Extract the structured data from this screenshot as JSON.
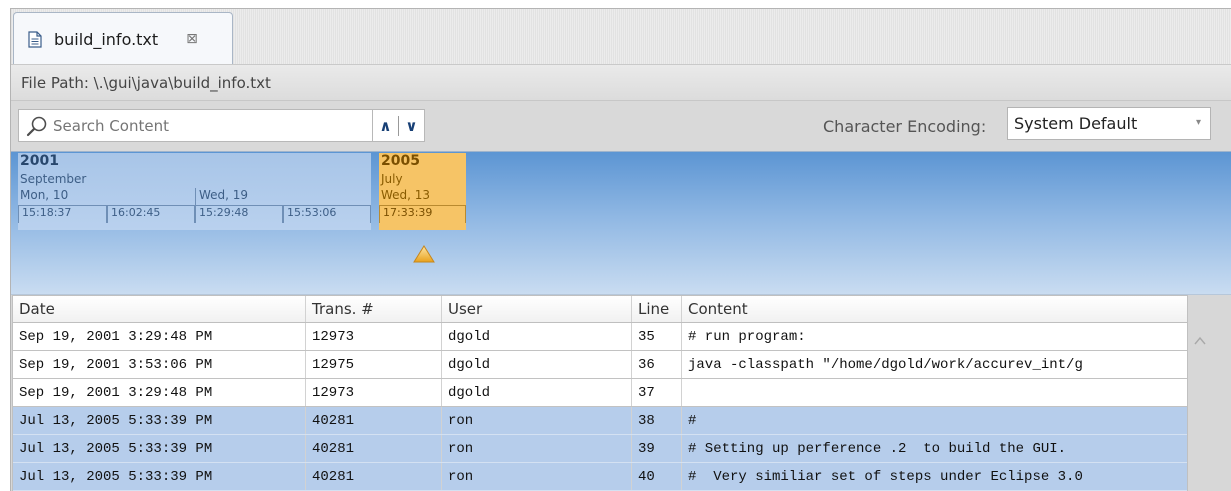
{
  "tab": {
    "label": "build_info.txt",
    "close_glyph": "⊠",
    "icon": "document-icon"
  },
  "path": {
    "text": "File Path: \\.\\gui\\java\\build_info.txt"
  },
  "search": {
    "placeholder": "Search Content",
    "prev_glyph": "∧",
    "next_glyph": "∨"
  },
  "encoding": {
    "label": "Character Encoding:",
    "value": "System Default"
  },
  "timeline": {
    "groups": [
      {
        "year": "2001",
        "month": "September",
        "days": [
          "Mon, 10",
          "Wed, 19"
        ],
        "times": [
          "15:18:37",
          "16:02:45",
          "15:29:48",
          "15:53:06"
        ]
      },
      {
        "year": "2005",
        "month": "July",
        "days": [
          "Wed, 13"
        ],
        "times": [
          "17:33:39"
        ],
        "selected": true
      }
    ]
  },
  "table": {
    "columns": [
      "Date",
      "Trans. #",
      "User",
      "Line",
      "Content"
    ],
    "rows": [
      {
        "date": "Sep 19, 2001 3:29:48 PM",
        "trans": "12973",
        "user": "dgold",
        "line": "35",
        "content": "# run program:",
        "selected": false
      },
      {
        "date": "Sep 19, 2001 3:53:06 PM",
        "trans": "12975",
        "user": "dgold",
        "line": "36",
        "content": "java -classpath \"/home/dgold/work/accurev_int/g",
        "selected": false
      },
      {
        "date": "Sep 19, 2001 3:29:48 PM",
        "trans": "12973",
        "user": "dgold",
        "line": "37",
        "content": "",
        "selected": false
      },
      {
        "date": "Jul 13, 2005 5:33:39 PM",
        "trans": "40281",
        "user": "ron",
        "line": "38",
        "content": "#",
        "selected": true
      },
      {
        "date": "Jul 13, 2005 5:33:39 PM",
        "trans": "40281",
        "user": "ron",
        "line": "39",
        "content": "# Setting up perference .2  to build the GUI.",
        "selected": true
      },
      {
        "date": "Jul 13, 2005 5:33:39 PM",
        "trans": "40281",
        "user": "ron",
        "line": "40",
        "content": "#  Very similiar set of steps under Eclipse 3.0",
        "selected": true
      }
    ]
  },
  "colors": {
    "selection": "#b6cdeb",
    "timeline_highlight": "#f6c466",
    "timeline_bg": "#5c95d3"
  }
}
